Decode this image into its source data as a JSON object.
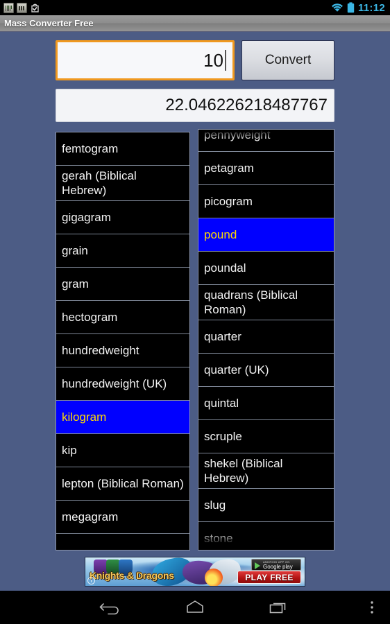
{
  "statusbar": {
    "notifications": [
      "notification-icon-app",
      "notification-icon-news",
      "notification-icon-task"
    ],
    "wifi_icon": "wifi-icon",
    "battery_icon": "battery-icon",
    "clock": "11:12",
    "accent_color": "#3bb6e4"
  },
  "titlebar": {
    "app_title": "Mass Converter Free"
  },
  "converter": {
    "input_value": "10",
    "input_placeholder": "",
    "convert_label": "Convert",
    "result_value": "22.046226218487767",
    "focus_border_color": "#f0991f",
    "selected_bg_color": "#0000ff",
    "selected_text_color": "#ffd900"
  },
  "from_list": {
    "name": "from-unit-list",
    "selected": "kilogram",
    "items": [
      {
        "label": "femtogram",
        "selected": false
      },
      {
        "label": "gerah (Biblical Hebrew)",
        "selected": false
      },
      {
        "label": "gigagram",
        "selected": false
      },
      {
        "label": "grain",
        "selected": false
      },
      {
        "label": "gram",
        "selected": false
      },
      {
        "label": "hectogram",
        "selected": false
      },
      {
        "label": "hundredweight",
        "selected": false
      },
      {
        "label": "hundredweight (UK)",
        "selected": false
      },
      {
        "label": "kilogram",
        "selected": true
      },
      {
        "label": "kip",
        "selected": false
      },
      {
        "label": "lepton (Biblical Roman)",
        "selected": false
      },
      {
        "label": "megagram",
        "selected": false
      },
      {
        "label": "",
        "selected": false
      }
    ]
  },
  "to_list": {
    "name": "to-unit-list",
    "selected": "pound",
    "items": [
      {
        "label": "pennyweight",
        "selected": false
      },
      {
        "label": "petagram",
        "selected": false
      },
      {
        "label": "picogram",
        "selected": false
      },
      {
        "label": "pound",
        "selected": true
      },
      {
        "label": "poundal",
        "selected": false
      },
      {
        "label": "quadrans (Biblical Roman)",
        "selected": false
      },
      {
        "label": "quarter",
        "selected": false
      },
      {
        "label": "quarter (UK)",
        "selected": false
      },
      {
        "label": "quintal",
        "selected": false
      },
      {
        "label": "scruple",
        "selected": false
      },
      {
        "label": "shekel (Biblical Hebrew)",
        "selected": false
      },
      {
        "label": "slug",
        "selected": false
      },
      {
        "label": "stone",
        "selected": false
      }
    ]
  },
  "ad": {
    "title": "Knights & Dragons",
    "store_badge_top": "ANDROID APP ON",
    "store_badge_main": "Google play",
    "cta_label": "PLAY FREE",
    "info_label": "i"
  },
  "navbar": {
    "back_icon": "back-icon",
    "home_icon": "home-icon",
    "recents_icon": "recents-icon",
    "menu_icon": "overflow-menu-icon"
  }
}
